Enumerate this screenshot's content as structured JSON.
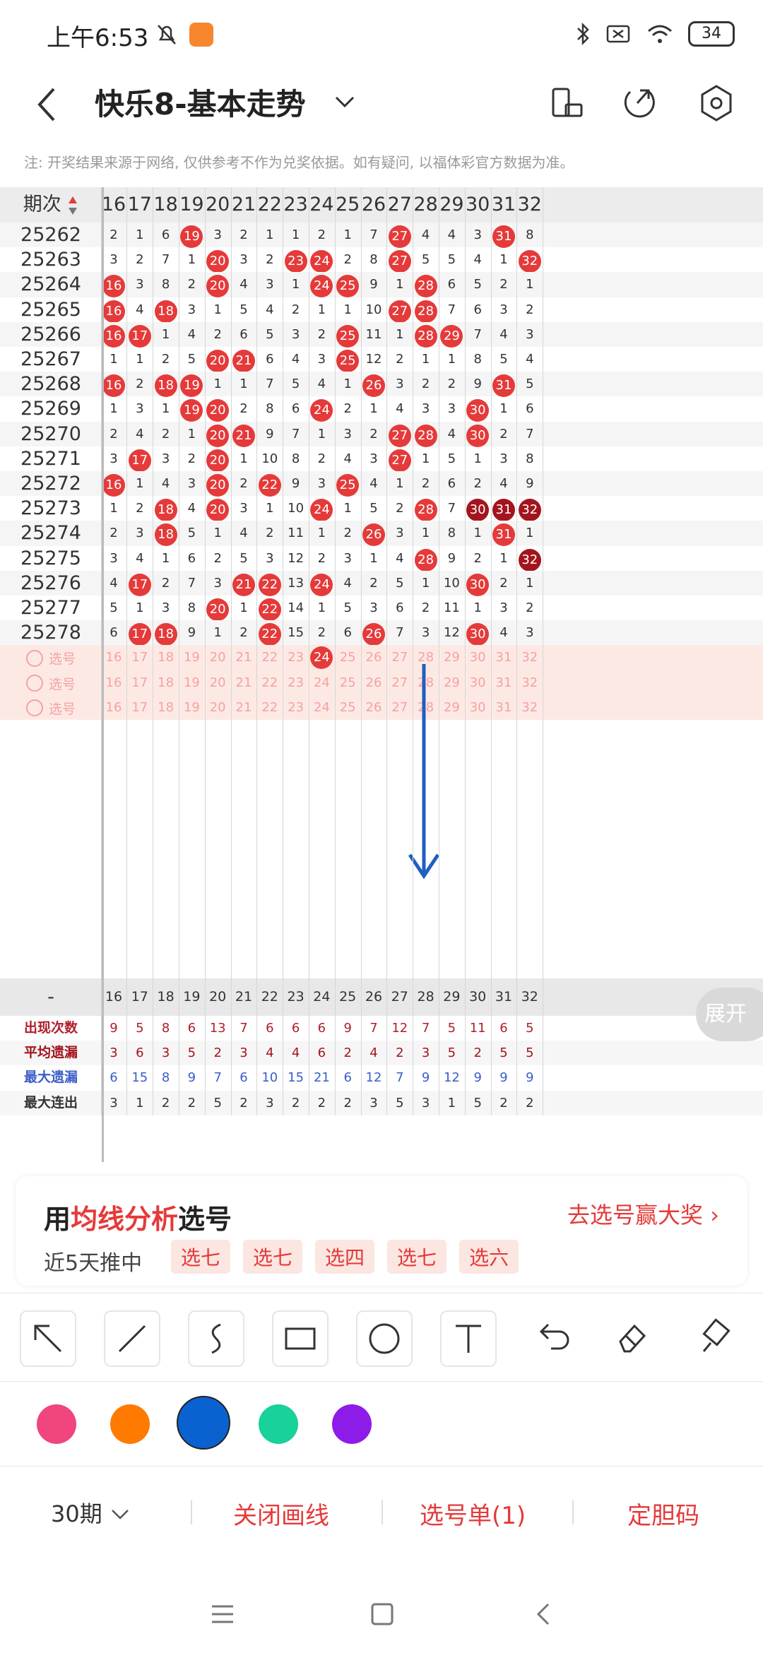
{
  "status_bar": {
    "time": "上午6:53",
    "battery": "34"
  },
  "header": {
    "title": "快乐8-基本走势"
  },
  "note": "注: 开奖结果来源于网络, 仅供参考不作为兑奖依据。如有疑问, 以福体彩官方数据为准。",
  "table": {
    "period_header": "期次",
    "numbers": [
      "16",
      "17",
      "18",
      "19",
      "20",
      "21",
      "22",
      "23",
      "24",
      "25",
      "26",
      "27",
      "28",
      "29",
      "30",
      "31",
      "32"
    ],
    "rows": [
      {
        "period": "25262",
        "cells": [
          "2",
          "1",
          "6",
          "19",
          "3",
          "2",
          "1",
          "1",
          "2",
          "1",
          "7",
          "27",
          "4",
          "4",
          "3",
          "31",
          "8"
        ],
        "balls": [
          3,
          11,
          15
        ]
      },
      {
        "period": "25263",
        "cells": [
          "3",
          "2",
          "7",
          "1",
          "20",
          "3",
          "2",
          "23",
          "24",
          "2",
          "8",
          "27",
          "5",
          "5",
          "4",
          "1",
          "32"
        ],
        "balls": [
          4,
          7,
          8,
          11,
          16
        ]
      },
      {
        "period": "25264",
        "cells": [
          "16",
          "3",
          "8",
          "2",
          "20",
          "4",
          "3",
          "1",
          "24",
          "25",
          "9",
          "1",
          "28",
          "6",
          "5",
          "2",
          "1"
        ],
        "balls": [
          0,
          4,
          8,
          9,
          12
        ]
      },
      {
        "period": "25265",
        "cells": [
          "16",
          "4",
          "18",
          "3",
          "1",
          "5",
          "4",
          "2",
          "1",
          "1",
          "10",
          "27",
          "28",
          "7",
          "6",
          "3",
          "2"
        ],
        "balls": [
          0,
          2,
          11,
          12
        ]
      },
      {
        "period": "25266",
        "cells": [
          "16",
          "17",
          "1",
          "4",
          "2",
          "6",
          "5",
          "3",
          "2",
          "25",
          "11",
          "1",
          "28",
          "29",
          "7",
          "4",
          "3"
        ],
        "balls": [
          0,
          1,
          9,
          12,
          13
        ]
      },
      {
        "period": "25267",
        "cells": [
          "1",
          "1",
          "2",
          "5",
          "20",
          "21",
          "6",
          "4",
          "3",
          "25",
          "12",
          "2",
          "1",
          "1",
          "8",
          "5",
          "4"
        ],
        "balls": [
          4,
          5,
          9
        ]
      },
      {
        "period": "25268",
        "cells": [
          "16",
          "2",
          "18",
          "19",
          "1",
          "1",
          "7",
          "5",
          "4",
          "1",
          "26",
          "3",
          "2",
          "2",
          "9",
          "31",
          "5"
        ],
        "balls": [
          0,
          2,
          3,
          10,
          15
        ]
      },
      {
        "period": "25269",
        "cells": [
          "1",
          "3",
          "1",
          "19",
          "20",
          "2",
          "8",
          "6",
          "24",
          "2",
          "1",
          "4",
          "3",
          "3",
          "30",
          "1",
          "6"
        ],
        "balls": [
          3,
          4,
          8,
          14
        ]
      },
      {
        "period": "25270",
        "cells": [
          "2",
          "4",
          "2",
          "1",
          "20",
          "21",
          "9",
          "7",
          "1",
          "3",
          "2",
          "27",
          "28",
          "4",
          "30",
          "2",
          "7"
        ],
        "balls": [
          4,
          5,
          11,
          12,
          14
        ]
      },
      {
        "period": "25271",
        "cells": [
          "3",
          "17",
          "3",
          "2",
          "20",
          "1",
          "10",
          "8",
          "2",
          "4",
          "3",
          "27",
          "1",
          "5",
          "1",
          "3",
          "8"
        ],
        "balls": [
          1,
          4,
          11
        ]
      },
      {
        "period": "25272",
        "cells": [
          "16",
          "1",
          "4",
          "3",
          "20",
          "2",
          "22",
          "9",
          "3",
          "25",
          "4",
          "1",
          "2",
          "6",
          "2",
          "4",
          "9"
        ],
        "balls": [
          0,
          4,
          6,
          9
        ]
      },
      {
        "period": "25273",
        "cells": [
          "1",
          "2",
          "18",
          "4",
          "20",
          "3",
          "1",
          "10",
          "24",
          "1",
          "5",
          "2",
          "28",
          "7",
          "30",
          "31",
          "32"
        ],
        "balls": [
          2,
          4,
          8,
          12
        ],
        "dark": [
          14,
          15,
          16
        ]
      },
      {
        "period": "25274",
        "cells": [
          "2",
          "3",
          "18",
          "5",
          "1",
          "4",
          "2",
          "11",
          "1",
          "2",
          "26",
          "3",
          "1",
          "8",
          "1",
          "31",
          "1"
        ],
        "balls": [
          2,
          10,
          15
        ]
      },
      {
        "period": "25275",
        "cells": [
          "3",
          "4",
          "1",
          "6",
          "2",
          "5",
          "3",
          "12",
          "2",
          "3",
          "1",
          "4",
          "28",
          "9",
          "2",
          "1",
          "32"
        ],
        "balls": [
          12
        ],
        "dark": [
          16
        ]
      },
      {
        "period": "25276",
        "cells": [
          "4",
          "17",
          "2",
          "7",
          "3",
          "21",
          "22",
          "13",
          "24",
          "4",
          "2",
          "5",
          "1",
          "10",
          "30",
          "2",
          "1"
        ],
        "balls": [
          1,
          5,
          6,
          8,
          14
        ]
      },
      {
        "period": "25277",
        "cells": [
          "5",
          "1",
          "3",
          "8",
          "20",
          "1",
          "22",
          "14",
          "1",
          "5",
          "3",
          "6",
          "2",
          "11",
          "1",
          "3",
          "2"
        ],
        "balls": [
          4,
          6
        ]
      },
      {
        "period": "25278",
        "cells": [
          "6",
          "17",
          "18",
          "9",
          "1",
          "2",
          "22",
          "15",
          "2",
          "6",
          "26",
          "7",
          "3",
          "12",
          "30",
          "4",
          "3"
        ],
        "balls": [
          1,
          2,
          6,
          10,
          14
        ]
      }
    ],
    "pick_label": "选号",
    "pick_ball_index": 8,
    "stats": [
      {
        "label": "出现次数",
        "color": "#b01e2b",
        "values": [
          "9",
          "5",
          "8",
          "6",
          "13",
          "7",
          "6",
          "6",
          "6",
          "9",
          "7",
          "12",
          "7",
          "5",
          "11",
          "6",
          "5"
        ]
      },
      {
        "label": "平均遗漏",
        "color": "#a3141e",
        "values": [
          "3",
          "6",
          "3",
          "5",
          "2",
          "3",
          "4",
          "4",
          "6",
          "2",
          "4",
          "2",
          "3",
          "5",
          "2",
          "5",
          "5"
        ]
      },
      {
        "label": "最大遗漏",
        "color": "#3a5ec9",
        "values": [
          "6",
          "15",
          "8",
          "9",
          "7",
          "6",
          "10",
          "15",
          "21",
          "6",
          "12",
          "7",
          "9",
          "12",
          "9",
          "9",
          "9"
        ]
      },
      {
        "label": "最大连出",
        "color": "#333333",
        "values": [
          "3",
          "1",
          "2",
          "2",
          "5",
          "2",
          "3",
          "2",
          "2",
          "2",
          "3",
          "5",
          "3",
          "1",
          "5",
          "2",
          "2"
        ]
      }
    ],
    "summary_dash": "-",
    "expand_label": "展开"
  },
  "banner": {
    "prefix": "用",
    "highlight": "均线分析",
    "suffix": "选号",
    "action": "去选号赢大奖",
    "sub": "近5天推中",
    "tags": [
      "选七",
      "选七",
      "选四",
      "选七",
      "选六"
    ]
  },
  "palette": [
    "#f0457d",
    "#ff7a00",
    "#0a62d0",
    "#19d19a",
    "#8e1ce8"
  ],
  "bottom": {
    "period": "30期",
    "close": "关闭画线",
    "ticket": "选号单(1)",
    "fix": "定胆码"
  }
}
